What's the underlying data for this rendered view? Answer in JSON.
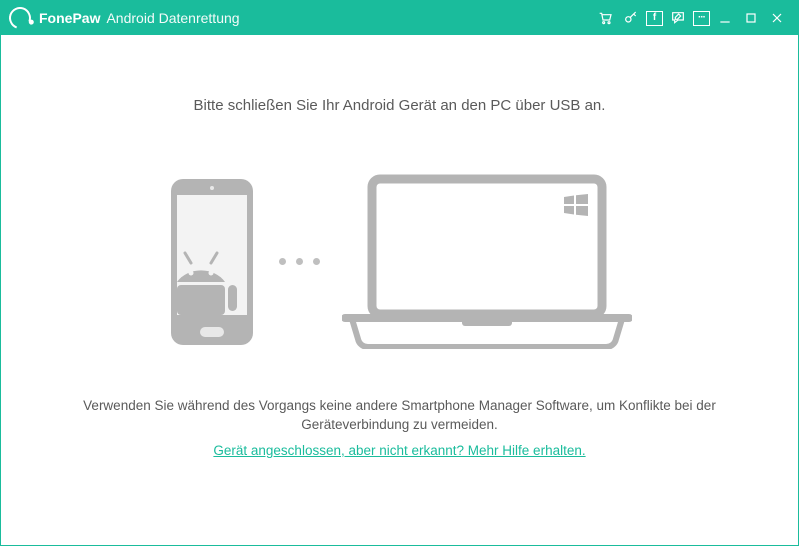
{
  "titlebar": {
    "brand": "FonePaw",
    "subtitle": "Android Datenrettung"
  },
  "main": {
    "instruction": "Bitte schließen Sie Ihr Android Gerät an den PC über USB an.",
    "warning": "Verwenden Sie während des Vorgangs keine andere Smartphone Manager Software, um Konflikte bei der Geräteverbindung zu vermeiden.",
    "help_link": "Gerät angeschlossen, aber nicht erkannt? Mehr Hilfe erhalten."
  },
  "colors": {
    "accent": "#1abc9c",
    "gray": "#b4b4b4"
  }
}
